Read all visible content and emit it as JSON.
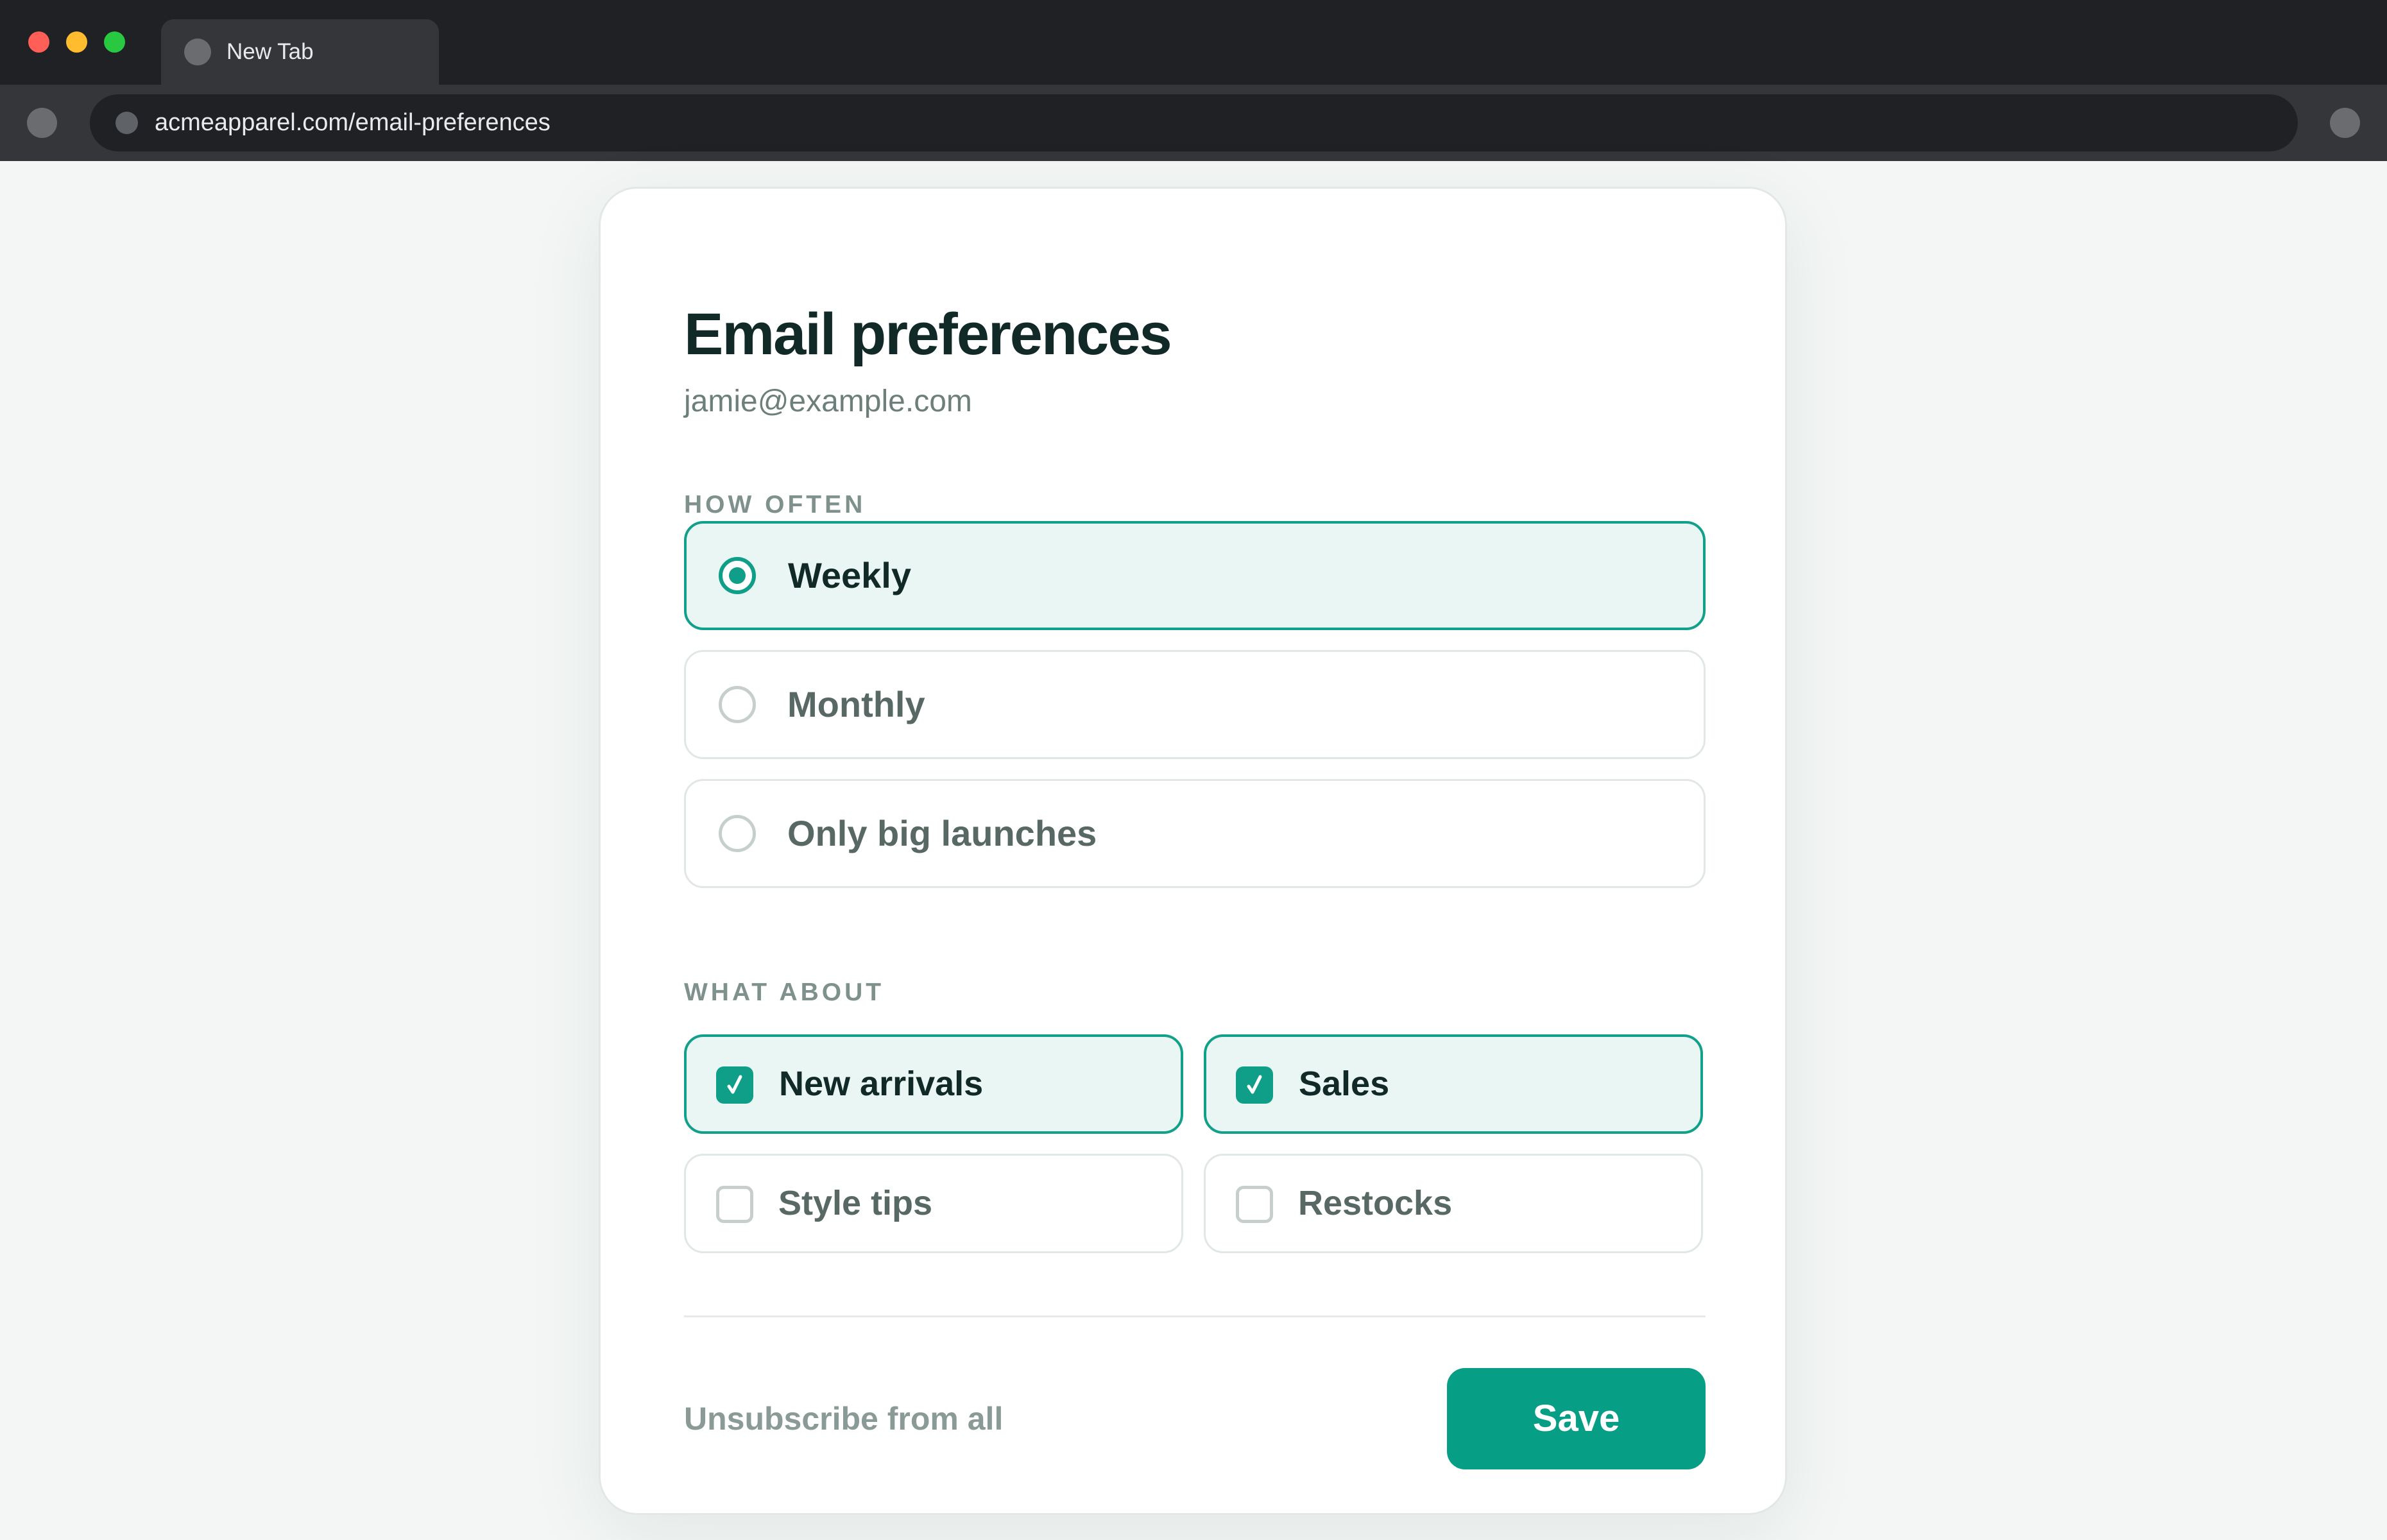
{
  "browser": {
    "tab_title": "New Tab",
    "url": "acmeapparel.com/email-preferences"
  },
  "page": {
    "title": "Email preferences",
    "email": "jamie@example.com"
  },
  "frequency": {
    "label": "HOW OFTEN",
    "options": [
      {
        "label": "Weekly",
        "selected": true
      },
      {
        "label": "Monthly",
        "selected": false
      },
      {
        "label": "Only big launches",
        "selected": false
      }
    ]
  },
  "topics": {
    "label": "WHAT ABOUT",
    "options": [
      {
        "label": "New arrivals",
        "checked": true
      },
      {
        "label": "Sales",
        "checked": true
      },
      {
        "label": "Style tips",
        "checked": false
      },
      {
        "label": "Restocks",
        "checked": false
      }
    ]
  },
  "footer": {
    "unsubscribe_label": "Unsubscribe from all",
    "save_label": "Save"
  },
  "colors": {
    "accent": "#0f9e88",
    "selected_bg": "#eaf6f3",
    "title_text": "#112a27",
    "muted_text": "#6d7f7b",
    "page_bg": "#f3f6f5"
  },
  "icons": {
    "checkbox_checked": "check-icon",
    "radio_selected": "radio-dot-icon"
  }
}
